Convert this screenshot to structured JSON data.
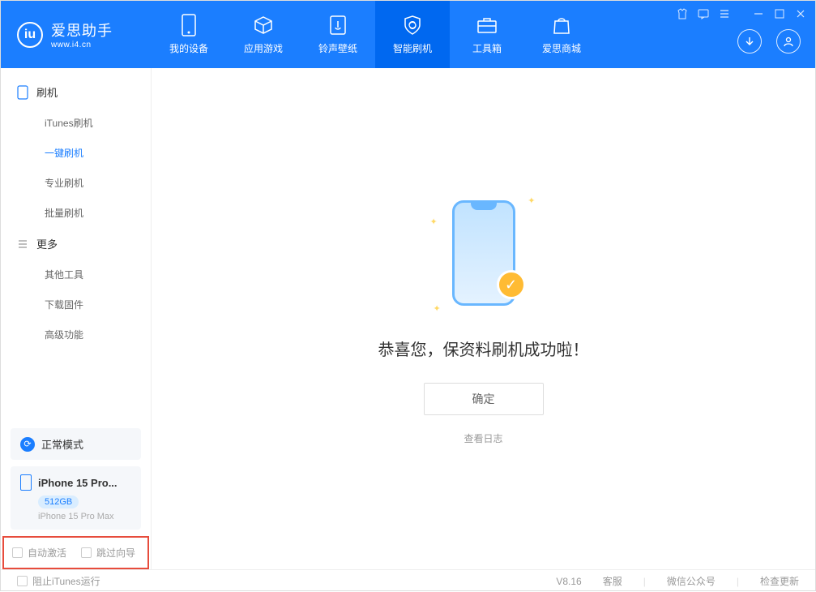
{
  "app": {
    "title": "爱思助手",
    "url": "www.i4.cn"
  },
  "nav": {
    "tabs": [
      {
        "label": "我的设备"
      },
      {
        "label": "应用游戏"
      },
      {
        "label": "铃声壁纸"
      },
      {
        "label": "智能刷机"
      },
      {
        "label": "工具箱"
      },
      {
        "label": "爱思商城"
      }
    ]
  },
  "sidebar": {
    "group1": {
      "title": "刷机",
      "items": [
        {
          "label": "iTunes刷机"
        },
        {
          "label": "一键刷机"
        },
        {
          "label": "专业刷机"
        },
        {
          "label": "批量刷机"
        }
      ]
    },
    "group2": {
      "title": "更多",
      "items": [
        {
          "label": "其他工具"
        },
        {
          "label": "下载固件"
        },
        {
          "label": "高级功能"
        }
      ]
    },
    "mode": "正常模式",
    "device": {
      "name": "iPhone 15 Pro...",
      "storage": "512GB",
      "model": "iPhone 15 Pro Max"
    },
    "checks": {
      "autoActivate": "自动激活",
      "skipGuide": "跳过向导"
    }
  },
  "main": {
    "title": "恭喜您，保资料刷机成功啦！",
    "okLabel": "确定",
    "logLink": "查看日志"
  },
  "footer": {
    "blockItunes": "阻止iTunes运行",
    "version": "V8.16",
    "links": {
      "support": "客服",
      "wechat": "微信公众号",
      "update": "检查更新"
    }
  }
}
